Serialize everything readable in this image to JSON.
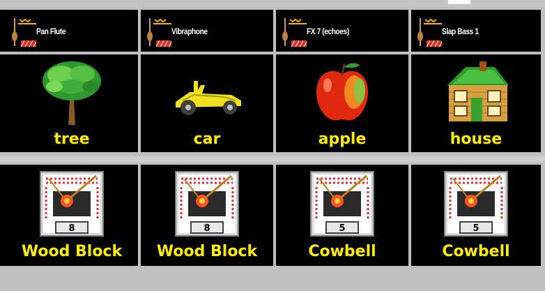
{
  "instruments": [
    {
      "name": "Pan Flute"
    },
    {
      "name": "Vibraphone"
    },
    {
      "name": "FX 7 (echoes)"
    },
    {
      "name": "Slap Bass 1"
    }
  ],
  "pictures": [
    {
      "label": "tree",
      "icon": "tree-icon"
    },
    {
      "label": "car",
      "icon": "car-icon"
    },
    {
      "label": "apple",
      "icon": "apple-icon"
    },
    {
      "label": "house",
      "icon": "house-icon"
    }
  ],
  "percussion": [
    {
      "label": "Wood Block",
      "number": "8"
    },
    {
      "label": "Wood Block",
      "number": "8"
    },
    {
      "label": "Cowbell",
      "number": "5"
    },
    {
      "label": "Cowbell",
      "number": "5"
    }
  ],
  "colors": {
    "caption": "#ffee00",
    "cell_bg": "#000000",
    "separator": "#c0c0c0"
  }
}
